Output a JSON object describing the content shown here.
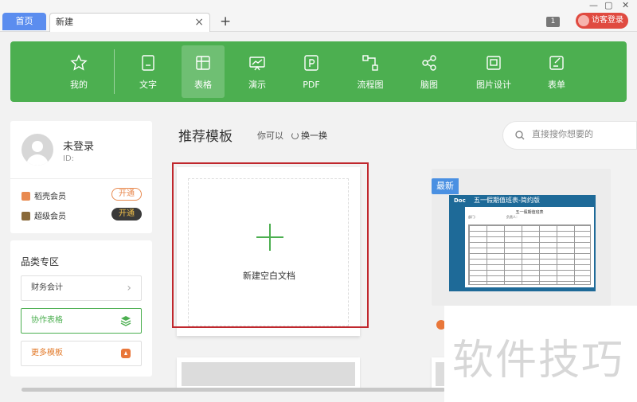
{
  "tabs": {
    "home": "首页",
    "active": "新建",
    "close": "×",
    "add": "+"
  },
  "titlebar": {
    "badge_count": "1",
    "guest_login": "访客登录",
    "minimize": "—",
    "maximize": "▢",
    "close": "✕"
  },
  "toolbar": {
    "items": [
      {
        "label": "我的",
        "icon": "star-icon"
      },
      {
        "label": "文字",
        "icon": "document-icon"
      },
      {
        "label": "表格",
        "icon": "table-icon",
        "active": true
      },
      {
        "label": "演示",
        "icon": "presentation-icon"
      },
      {
        "label": "PDF",
        "icon": "pdf-icon"
      },
      {
        "label": "流程图",
        "icon": "flowchart-icon"
      },
      {
        "label": "脑图",
        "icon": "mindmap-icon"
      },
      {
        "label": "图片设计",
        "icon": "image-design-icon"
      },
      {
        "label": "表单",
        "icon": "form-icon"
      }
    ]
  },
  "user": {
    "name": "未登录",
    "id_label": "ID:",
    "members": [
      {
        "label": "稻壳会员",
        "action": "开通",
        "color": "#e88a50"
      },
      {
        "label": "超级会员",
        "action": "开通",
        "color": "#8a6a3a"
      }
    ]
  },
  "categories": {
    "title": "品类专区",
    "items": [
      {
        "label": "财务会计",
        "tail": "›"
      },
      {
        "label": "协作表格"
      },
      {
        "label": "更多模板"
      }
    ]
  },
  "main": {
    "title": "推荐模板",
    "hint": "你可以",
    "refresh": "换一换",
    "search_placeholder": "直接搜你想要的"
  },
  "blank_doc": {
    "label": "新建空白文档"
  },
  "template": {
    "badge": "最新",
    "logo": "Doc",
    "title": "五一假期值班表-简约版",
    "sheet_title": "五一假期值班表",
    "sheet_field_1": "部门：",
    "sheet_field_2": "负责人："
  },
  "watermark": "软件技巧",
  "colors": {
    "accent": "#4caf50",
    "highlight": "#c0272d",
    "tab_home": "#5b8def",
    "badge": "#4a90e2"
  }
}
